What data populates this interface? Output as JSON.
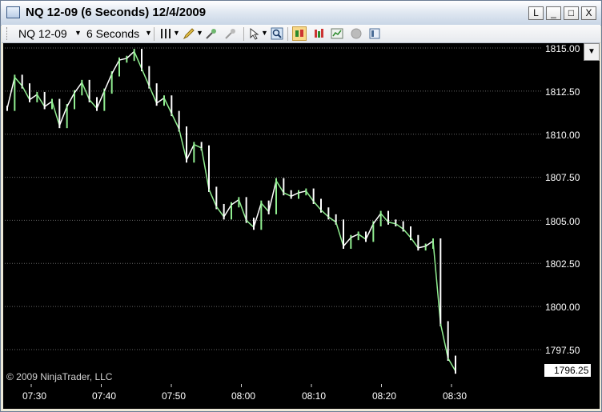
{
  "window": {
    "title": "NQ 12-09 (6 Seconds)  12/4/2009",
    "buttons": [
      "L",
      "_",
      "□",
      "X"
    ]
  },
  "toolbar": {
    "instrument": "NQ 12-09",
    "interval": "6 Seconds",
    "icons": [
      "bar-type-icon",
      "pencil-icon",
      "zoom-in-icon",
      "zoom-out-icon",
      "cursor-icon",
      "magnifier-icon",
      "candlestick-icon",
      "bars-icon",
      "chart-icon",
      "stop-icon",
      "properties-icon"
    ]
  },
  "chart": {
    "copyright": "© 2009 NinjaTrader, LLC",
    "current_price": "1796.25",
    "colors": {
      "background": "#000000",
      "bar": "#ffffff",
      "rising": "#90ee90",
      "grid": "#555555"
    }
  },
  "chart_data": {
    "type": "line",
    "title": "",
    "xlabel": "",
    "ylabel": "",
    "x_ticks": [
      "07:30",
      "07:40",
      "07:50",
      "08:00",
      "08:10",
      "08:20",
      "08:30"
    ],
    "y_ticks": [
      "1815.00",
      "1812.50",
      "1810.00",
      "1807.50",
      "1805.00",
      "1802.50",
      "1800.00",
      "1797.50"
    ],
    "ylim": [
      1795.5,
      1815.25
    ],
    "series": [
      {
        "x": [
          "07:30",
          "07:31",
          "07:32",
          "07:33",
          "07:34",
          "07:35",
          "07:36",
          "07:37",
          "07:38",
          "07:39",
          "07:40",
          "07:41",
          "07:42",
          "07:43",
          "07:44",
          "07:45",
          "07:46",
          "07:47",
          "07:48",
          "07:49",
          "07:50",
          "07:51",
          "07:52",
          "07:53",
          "07:54",
          "07:55",
          "07:56",
          "07:57",
          "07:58",
          "07:59",
          "08:00",
          "08:01",
          "08:02",
          "08:03",
          "08:04",
          "08:05",
          "08:06",
          "08:07",
          "08:08",
          "08:09",
          "08:10",
          "08:11",
          "08:12",
          "08:13",
          "08:14",
          "08:15",
          "08:16",
          "08:17",
          "08:18",
          "08:19",
          "08:20",
          "08:21",
          "08:22",
          "08:23",
          "08:24",
          "08:25",
          "08:26",
          "08:27",
          "08:28",
          "08:29",
          "08:30"
        ],
        "values": [
          1811.5,
          1813.3,
          1812.8,
          1812.0,
          1812.3,
          1811.6,
          1811.9,
          1810.5,
          1811.6,
          1812.4,
          1813.0,
          1812.0,
          1811.5,
          1812.5,
          1813.5,
          1814.3,
          1814.4,
          1814.8,
          1813.8,
          1812.8,
          1811.8,
          1812.1,
          1811.2,
          1810.3,
          1808.5,
          1809.4,
          1809.2,
          1806.8,
          1805.8,
          1805.2,
          1805.9,
          1806.2,
          1805.0,
          1804.6,
          1806.0,
          1805.5,
          1807.3,
          1806.6,
          1806.4,
          1806.6,
          1806.7,
          1806.1,
          1805.6,
          1805.2,
          1804.9,
          1803.5,
          1804.0,
          1804.2,
          1803.9,
          1804.8,
          1805.4,
          1804.9,
          1804.8,
          1804.5,
          1804.0,
          1803.4,
          1803.5,
          1803.8,
          1799.0,
          1797.0,
          1796.25
        ]
      }
    ],
    "grid": true,
    "axis_position": "right"
  }
}
